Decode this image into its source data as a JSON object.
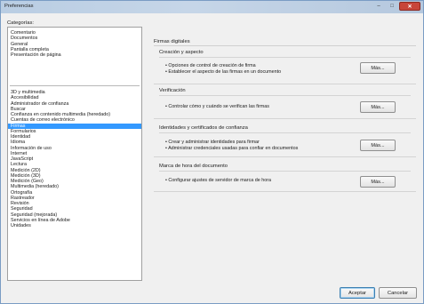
{
  "window": {
    "title": "Preferencias",
    "close_glyph": "✕",
    "minimize_glyph": "–",
    "maximize_glyph": "□"
  },
  "sidebar": {
    "label": "Categorías:",
    "group1": [
      "Comentario",
      "Documentos",
      "General",
      "Pantalla completa",
      "Presentación de página"
    ],
    "group2": [
      "3D y multimedia",
      "Accesibilidad",
      "Administrador de confianza",
      "Buscar",
      "Confianza en contenido multimedia (heredado)",
      "Cuentas de correo electrónico",
      "Firmas",
      "Formularios",
      "Identidad",
      "Idioma",
      "Información de uso",
      "Internet",
      "JavaScript",
      "Lectura",
      "Medición (2D)",
      "Medición (3D)",
      "Medición (Geo)",
      "Multimedia (heredado)",
      "Ortografía",
      "Rastreador",
      "Revisión",
      "Seguridad",
      "Seguridad (mejorada)",
      "Servicios en línea de Adobe",
      "Unidades"
    ],
    "selected": "Firmas"
  },
  "main": {
    "title": "Firmas digitales",
    "sections": [
      {
        "heading": "Creación y aspecto",
        "bullets": [
          "• Opciones de control de creación de firma",
          "• Establecer el aspecto de las firmas en un documento"
        ],
        "button": "Más..."
      },
      {
        "heading": "Verificación",
        "bullets": [
          "• Controlar cómo y cuándo se verifican las firmas"
        ],
        "button": "Más..."
      },
      {
        "heading": "Identidades y certificados de confianza",
        "bullets": [
          "• Crear y administrar identidades para firmar",
          "• Administrar credenciales usadas para confiar en documentos"
        ],
        "button": "Más..."
      },
      {
        "heading": "Marca de hora del documento",
        "bullets": [
          "• Configurar ajustes de servidor de marca de hora"
        ],
        "button": "Más..."
      }
    ]
  },
  "footer": {
    "ok_label": "Aceptar",
    "cancel_label": "Cancelar"
  }
}
